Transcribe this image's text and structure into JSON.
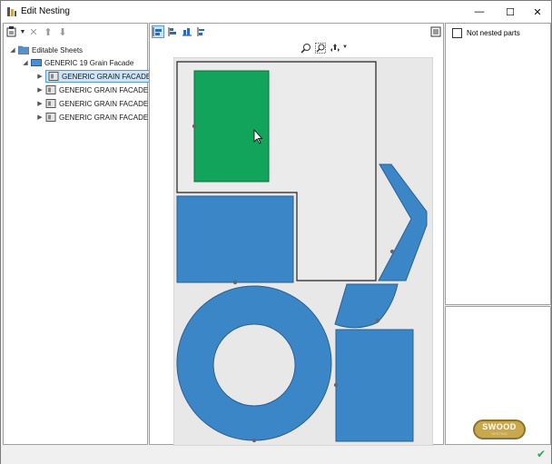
{
  "window": {
    "title": "Edit Nesting",
    "minimize_glyph": "—",
    "maximize_glyph": "☐",
    "close_glyph": "✕"
  },
  "left_toolbar": {
    "icons": [
      "sheet-add-icon",
      "dropdown-arrow-icon",
      "delete-icon",
      "move-up-icon",
      "move-down-icon"
    ]
  },
  "tree": {
    "root": "Editable Sheets",
    "group": "GENERIC 19 Grain Facade",
    "sheets": [
      "GENERIC GRAIN FACADE",
      "GENERIC GRAIN FACADE",
      "GENERIC GRAIN FACADE",
      "GENERIC GRAIN FACADE"
    ],
    "selected_index": 0
  },
  "view_toolbar": {
    "icons": [
      "align-left-icon",
      "align-right-icon",
      "align-bottom-icon",
      "align-top-icon",
      "list-view-icon"
    ],
    "zoom_icons": [
      "zoom-in-icon",
      "zoom-fit-icon",
      "pan-icon",
      "dropdown-arrow-icon"
    ]
  },
  "not_nested": {
    "label": "Not nested parts"
  },
  "logo": {
    "main": "SWOOD",
    "sub": "NESTING"
  },
  "colors": {
    "part_blue": "#3b86c7",
    "part_blue_border": "#2a5f93",
    "part_selected_green": "#13a45c",
    "sheet_bg": "#e8e8e8",
    "outline": "#222222",
    "selection_blue": "#cce4f7",
    "status_check": "#2fa84f"
  }
}
